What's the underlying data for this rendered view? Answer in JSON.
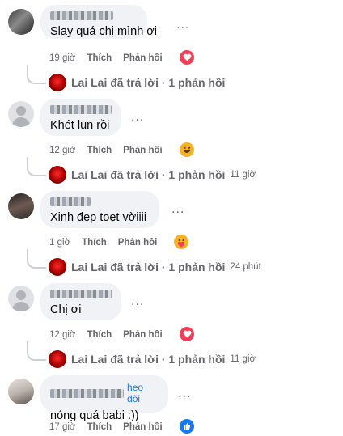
{
  "comments": [
    {
      "text": "Slay quá chị mình ơi",
      "time": "19 giờ",
      "like": "Thích",
      "reply": "Phản hồi",
      "reaction": "heart",
      "reply_summary": "Lai Lai đã trả lời · 1 phản hồi",
      "reply_time": ""
    },
    {
      "text": "Khét lun rồi",
      "time": "12 giờ",
      "like": "Thích",
      "reply": "Phản hồi",
      "reaction": "haha",
      "reply_summary": "Lai Lai đã trả lời · 1 phản hồi",
      "reply_time": "11 giờ"
    },
    {
      "text": "Xinh đẹp toẹt vờiiii",
      "time": "1 giờ",
      "like": "Thích",
      "reply": "Phản hồi",
      "reaction": "care",
      "reply_summary": "Lai Lai đã trả lời · 1 phản hồi",
      "reply_time": "24 phút"
    },
    {
      "text": "Chị ơi",
      "time": "12 giờ",
      "like": "Thích",
      "reply": "Phản hồi",
      "reaction": "heart",
      "reply_summary": "Lai Lai đã trả lời · 1 phản hồi",
      "reply_time": "11 giờ"
    },
    {
      "text": "nóng quá babi :))",
      "follow": "heo dõi",
      "time": "17 giờ",
      "like": "Thích",
      "reply": "Phản hồi",
      "reaction": "like"
    }
  ],
  "more_options": "...",
  "colors": {
    "bubble": "#f0f2f5",
    "secondary_text": "#65676b",
    "heart": "#f33e58",
    "like": "#1877f2",
    "emoji": "#f7b125"
  }
}
